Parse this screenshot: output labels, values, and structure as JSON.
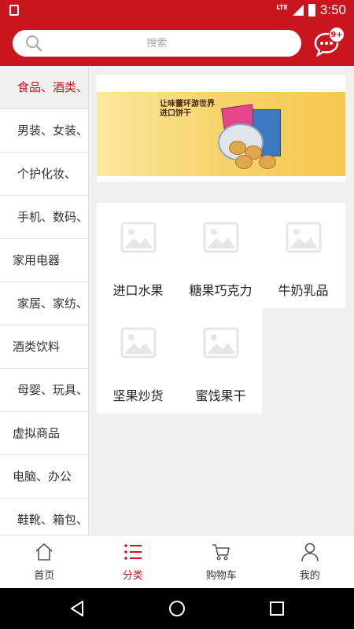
{
  "status_bar": {
    "network": "LTE",
    "time": "3:50"
  },
  "search": {
    "placeholder": "搜索"
  },
  "message": {
    "badge": "9+"
  },
  "sidebar": {
    "items": [
      {
        "label": "食品、酒类、",
        "active": true
      },
      {
        "label": "男装、女装、"
      },
      {
        "label": "个护化妆、"
      },
      {
        "label": "手机、数码、"
      },
      {
        "label": "家用电器"
      },
      {
        "label": "家居、家纺、"
      },
      {
        "label": "酒类饮料"
      },
      {
        "label": "母婴、玩具、"
      },
      {
        "label": "虚拟商品"
      },
      {
        "label": "电脑、办公"
      },
      {
        "label": "鞋靴、箱包、"
      }
    ]
  },
  "banner": {
    "title_line1": "让味蕾环游世界",
    "title_line2": "进口饼干"
  },
  "subcategories": [
    {
      "label": "进口水果"
    },
    {
      "label": "糖果巧克力"
    },
    {
      "label": "牛奶乳品"
    },
    {
      "label": "坚果炒货"
    },
    {
      "label": "蜜饯果干"
    }
  ],
  "tabs": [
    {
      "label": "首页",
      "icon": "home-icon"
    },
    {
      "label": "分类",
      "icon": "list-icon",
      "active": true
    },
    {
      "label": "购物车",
      "icon": "cart-icon"
    },
    {
      "label": "我的",
      "icon": "user-icon"
    }
  ],
  "colors": {
    "brand": "#c9151e",
    "text": "#333333",
    "background": "#f0f0f0"
  }
}
